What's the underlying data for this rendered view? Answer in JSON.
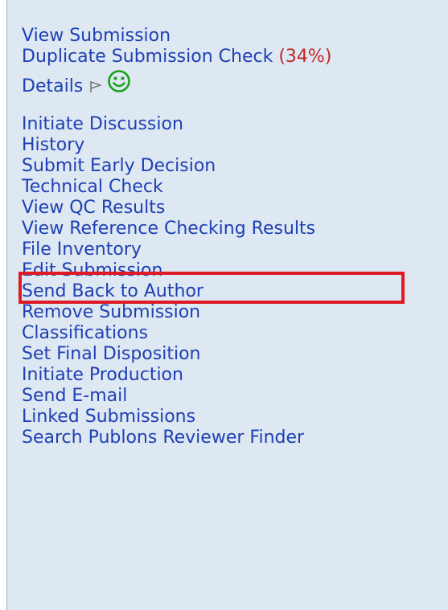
{
  "menu": {
    "view_submission": "View Submission",
    "duplicate_check": "Duplicate Submission Check",
    "duplicate_pct": "(34%)",
    "details": "Details",
    "flag_icon": "flag-outline-icon",
    "smile_icon": "smiley-face-icon",
    "items": [
      "Initiate Discussion",
      "History",
      "Submit Early Decision",
      "Technical Check",
      "View QC Results",
      "View Reference Checking Results",
      "File Inventory",
      "Edit Submission",
      "Send Back to Author",
      "Remove Submission",
      "Classifications",
      "Set Final Disposition",
      "Initiate Production",
      "Send E-mail",
      "Linked Submissions",
      "Search Publons Reviewer Finder"
    ],
    "highlighted_item": "View Reference Checking Results"
  },
  "colors": {
    "link": "#1f3fb4",
    "percent": "#c32727",
    "panel_bg": "#dde8f2",
    "highlight_border": "#e01a24",
    "smiley": "#18a218"
  }
}
